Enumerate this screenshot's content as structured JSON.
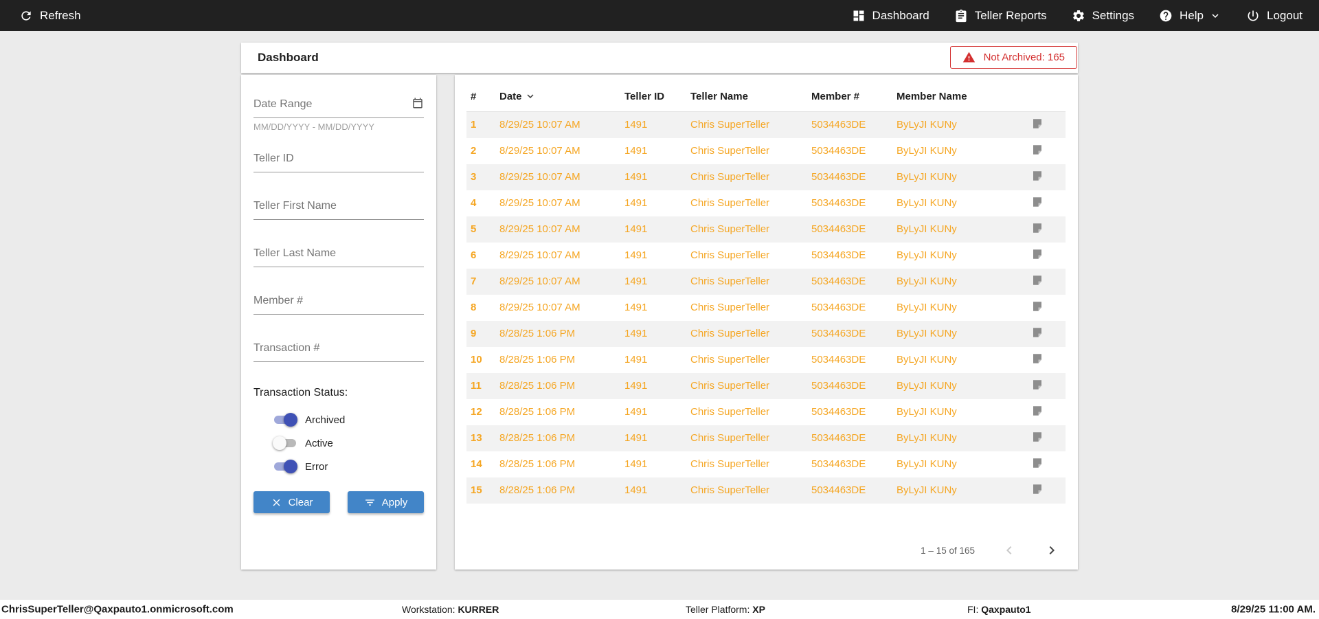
{
  "colors": {
    "topbar_bg": "#212121",
    "accent_blue": "#4285C8",
    "accent_orange": "#F5A623",
    "danger_red": "#D32F2F",
    "toggle_on_thumb": "#3F51B5",
    "toggle_on_track": "#9FA8DA",
    "row_alt_bg": "#F2F2F2"
  },
  "topbar": {
    "refresh_label": "Refresh",
    "nav": [
      {
        "label": "Dashboard",
        "icon": "dashboard-icon"
      },
      {
        "label": "Teller Reports",
        "icon": "teller-reports-icon"
      },
      {
        "label": "Settings",
        "icon": "settings-icon"
      },
      {
        "label": "Help",
        "icon": "help-icon",
        "has_dropdown": true
      },
      {
        "label": "Logout",
        "icon": "logout-icon"
      }
    ]
  },
  "page": {
    "title": "Dashboard",
    "not_archived_label": "Not Archived: 165"
  },
  "filters": {
    "date_range_label": "Date Range",
    "date_range_hint": "MM/DD/YYYY - MM/DD/YYYY",
    "fields": [
      "Teller ID",
      "Teller First Name",
      "Teller Last Name",
      "Member #",
      "Transaction #"
    ],
    "status_label": "Transaction Status:",
    "toggles": [
      {
        "label": "Archived",
        "on": true
      },
      {
        "label": "Active",
        "on": false
      },
      {
        "label": "Error",
        "on": true
      }
    ],
    "clear_label": "Clear",
    "apply_label": "Apply"
  },
  "table": {
    "columns": [
      "#",
      "Date",
      "Teller ID",
      "Teller Name",
      "Member #",
      "Member Name"
    ],
    "sort": {
      "column": "Date",
      "direction": "desc"
    },
    "rows": [
      {
        "num": "1",
        "date": "8/29/25 10:07 AM",
        "teller_id": "1491",
        "teller_name": "Chris SuperTeller",
        "member_num": "5034463DE",
        "member_name": "ByLyJI KUNy"
      },
      {
        "num": "2",
        "date": "8/29/25 10:07 AM",
        "teller_id": "1491",
        "teller_name": "Chris SuperTeller",
        "member_num": "5034463DE",
        "member_name": "ByLyJI KUNy"
      },
      {
        "num": "3",
        "date": "8/29/25 10:07 AM",
        "teller_id": "1491",
        "teller_name": "Chris SuperTeller",
        "member_num": "5034463DE",
        "member_name": "ByLyJI KUNy"
      },
      {
        "num": "4",
        "date": "8/29/25 10:07 AM",
        "teller_id": "1491",
        "teller_name": "Chris SuperTeller",
        "member_num": "5034463DE",
        "member_name": "ByLyJI KUNy"
      },
      {
        "num": "5",
        "date": "8/29/25 10:07 AM",
        "teller_id": "1491",
        "teller_name": "Chris SuperTeller",
        "member_num": "5034463DE",
        "member_name": "ByLyJI KUNy"
      },
      {
        "num": "6",
        "date": "8/29/25 10:07 AM",
        "teller_id": "1491",
        "teller_name": "Chris SuperTeller",
        "member_num": "5034463DE",
        "member_name": "ByLyJI KUNy"
      },
      {
        "num": "7",
        "date": "8/29/25 10:07 AM",
        "teller_id": "1491",
        "teller_name": "Chris SuperTeller",
        "member_num": "5034463DE",
        "member_name": "ByLyJI KUNy"
      },
      {
        "num": "8",
        "date": "8/29/25 10:07 AM",
        "teller_id": "1491",
        "teller_name": "Chris SuperTeller",
        "member_num": "5034463DE",
        "member_name": "ByLyJI KUNy"
      },
      {
        "num": "9",
        "date": "8/28/25 1:06 PM",
        "teller_id": "1491",
        "teller_name": "Chris SuperTeller",
        "member_num": "5034463DE",
        "member_name": "ByLyJI KUNy"
      },
      {
        "num": "10",
        "date": "8/28/25 1:06 PM",
        "teller_id": "1491",
        "teller_name": "Chris SuperTeller",
        "member_num": "5034463DE",
        "member_name": "ByLyJI KUNy"
      },
      {
        "num": "11",
        "date": "8/28/25 1:06 PM",
        "teller_id": "1491",
        "teller_name": "Chris SuperTeller",
        "member_num": "5034463DE",
        "member_name": "ByLyJI KUNy"
      },
      {
        "num": "12",
        "date": "8/28/25 1:06 PM",
        "teller_id": "1491",
        "teller_name": "Chris SuperTeller",
        "member_num": "5034463DE",
        "member_name": "ByLyJI KUNy"
      },
      {
        "num": "13",
        "date": "8/28/25 1:06 PM",
        "teller_id": "1491",
        "teller_name": "Chris SuperTeller",
        "member_num": "5034463DE",
        "member_name": "ByLyJI KUNy"
      },
      {
        "num": "14",
        "date": "8/28/25 1:06 PM",
        "teller_id": "1491",
        "teller_name": "Chris SuperTeller",
        "member_num": "5034463DE",
        "member_name": "ByLyJI KUNy"
      },
      {
        "num": "15",
        "date": "8/28/25 1:06 PM",
        "teller_id": "1491",
        "teller_name": "Chris SuperTeller",
        "member_num": "5034463DE",
        "member_name": "ByLyJI KUNy"
      }
    ],
    "pagination": "1 – 15 of 165"
  },
  "footer": {
    "user": "ChrisSuperTeller@Qaxpauto1.onmicrosoft.com",
    "workstation_label": "Workstation:",
    "workstation_value": "KURRER",
    "platform_label": "Teller Platform:",
    "platform_value": "XP",
    "fi_label": "FI:",
    "fi_value": "Qaxpauto1",
    "datetime": "8/29/25 11:00 AM."
  }
}
